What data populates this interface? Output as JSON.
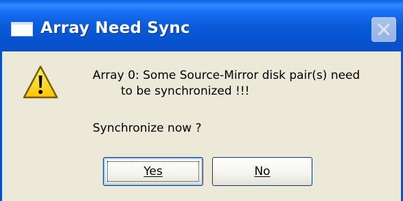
{
  "window": {
    "title": "Array Need Sync"
  },
  "message": {
    "line1": "Array 0: Some Source-Mirror disk pair(s) need",
    "line2": "to be synchronized !!!",
    "question": "Synchronize now ?"
  },
  "buttons": {
    "yes_label": "Yes",
    "no_label": "No"
  },
  "icons": {
    "window_icon": "window-icon",
    "close_icon": "close-icon",
    "warning_icon": "warning-icon"
  },
  "colors": {
    "titlebar": "#0a5ee8",
    "dialog_background": "#ece9d8",
    "warning_yellow": "#ffd200",
    "button_border": "#003c74"
  }
}
